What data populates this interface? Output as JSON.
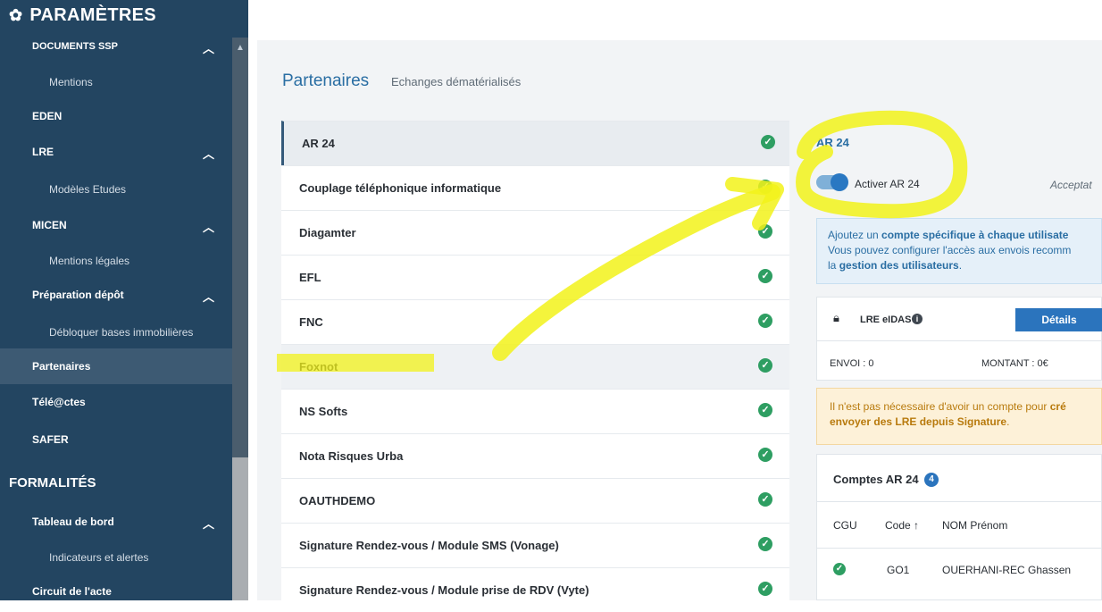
{
  "sidebar": {
    "title": "PARAMÈTRES",
    "items": [
      {
        "label": "Documents SSP"
      },
      {
        "label": "Mentions"
      },
      {
        "label": "EDEN"
      },
      {
        "label": "LRE"
      },
      {
        "label": "Modèles Etudes"
      },
      {
        "label": "MICEN"
      },
      {
        "label": "Mentions légales"
      },
      {
        "label": "Préparation dépôt"
      },
      {
        "label": "Débloquer bases immobilières"
      },
      {
        "label": "Partenaires"
      },
      {
        "label": "Télé@ctes"
      },
      {
        "label": "SAFER"
      },
      {
        "label": "FORMALITÉS"
      },
      {
        "label": "Tableau de bord"
      },
      {
        "label": "Indicateurs et alertes"
      },
      {
        "label": "Circuit de l'acte"
      }
    ]
  },
  "main": {
    "title": "Partenaires",
    "subtitle": "Echanges dématérialisés",
    "partners": [
      "AR 24",
      "Couplage téléphonique informatique",
      "Diagamter",
      "EFL",
      "FNC",
      "Foxnot",
      "NS Softs",
      "Nota Risques Urba",
      "OAUTHDEMO",
      "Signature Rendez-vous / Module SMS (Vonage)",
      "Signature Rendez-vous / Module prise de RDV (Vyte)"
    ]
  },
  "detail": {
    "title": "AR 24",
    "toggle_label": "Activer AR 24",
    "accept_label": "Acceptat",
    "info_line1_a": "Ajoutez un ",
    "info_line1_b": "compte spécifique à chaque utilisate",
    "info_line2": "Vous pouvez configurer l'accès aux envois recomm",
    "info_line3_a": "la ",
    "info_line3_b": "gestion des utilisateurs",
    "info_line3_c": ".",
    "lre_name": "LRE eIDAS",
    "details_button": "Détails",
    "envoi": "ENVOI : 0",
    "montant": "MONTANT : 0€",
    "warn_line1_a": "Il n'est pas nécessaire d'avoir un compte pour ",
    "warn_line1_b": "cré",
    "warn_line2": "envoyer des LRE depuis Signature",
    "warn_line2_end": ".",
    "accounts_title": "Comptes AR 24",
    "accounts_count": "4",
    "col_cgu": "CGU",
    "col_code": "Code ↑",
    "col_name": "NOM Prénom",
    "row_code": "GO1",
    "row_name": "OUERHANI-REC Ghassen"
  },
  "colors": {
    "sidebar": "#234561",
    "accent": "#2a6ea3",
    "success": "#2e9e62",
    "highlighter": "#f2f21a"
  }
}
